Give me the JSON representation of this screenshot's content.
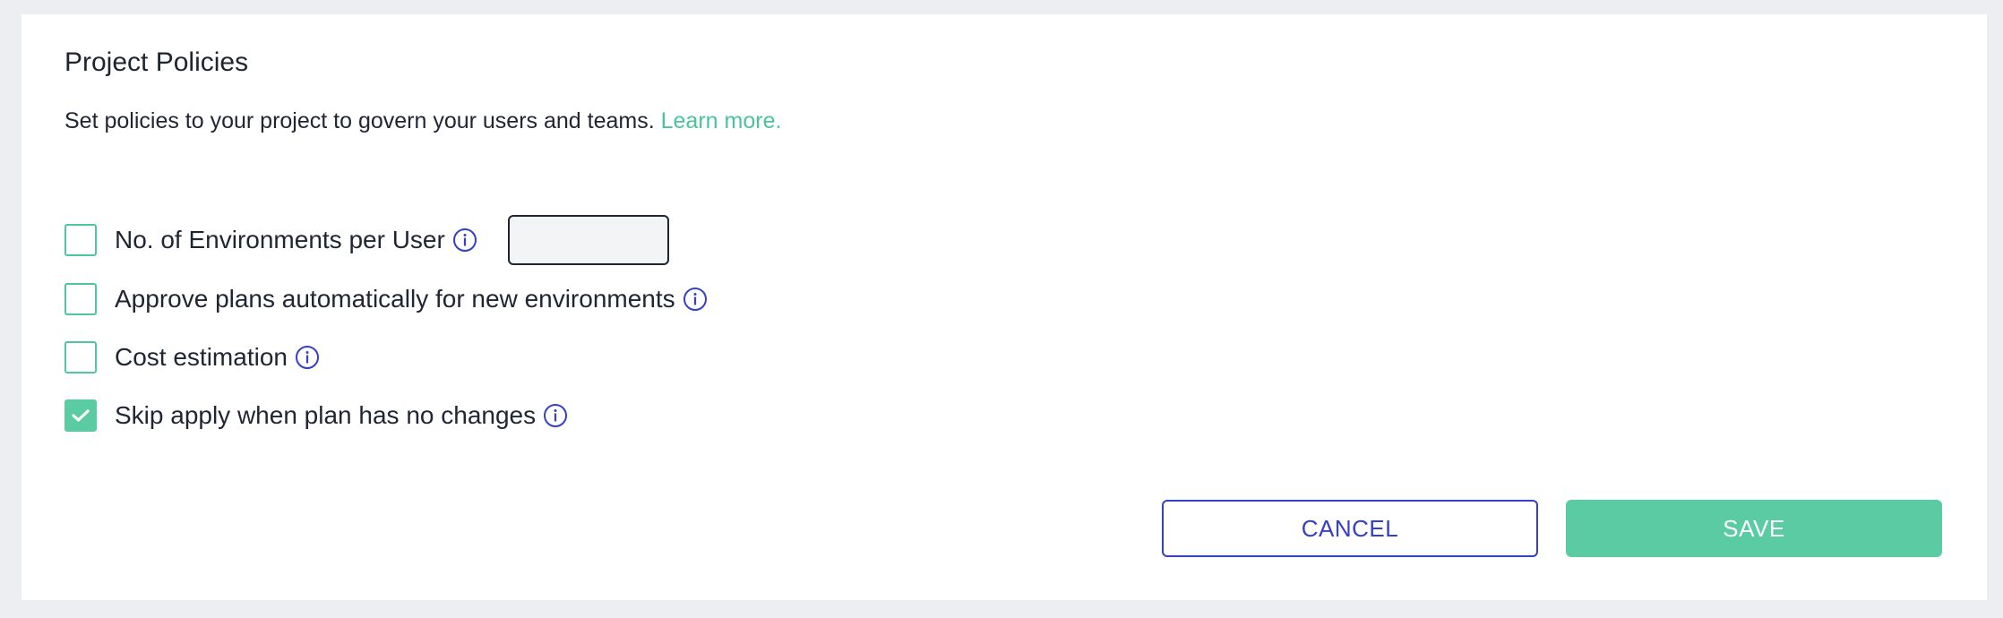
{
  "header": {
    "title": "Project Policies",
    "description": "Set policies to your project to govern your users and teams.",
    "learn_more": "Learn more."
  },
  "policies": [
    {
      "label": "No. of Environments per User",
      "checked": false,
      "has_input": true,
      "input_value": ""
    },
    {
      "label": "Approve plans automatically for new environments",
      "checked": false
    },
    {
      "label": "Cost estimation",
      "checked": false
    },
    {
      "label": "Skip apply when plan has no changes",
      "checked": true
    }
  ],
  "actions": {
    "cancel_label": "CANCEL",
    "save_label": "SAVE"
  },
  "icons": {
    "info": "info-circle-icon",
    "check": "checkmark-icon"
  },
  "colors": {
    "accent_green": "#5acba2",
    "accent_blue": "#3440c8",
    "text": "#1f2533"
  }
}
